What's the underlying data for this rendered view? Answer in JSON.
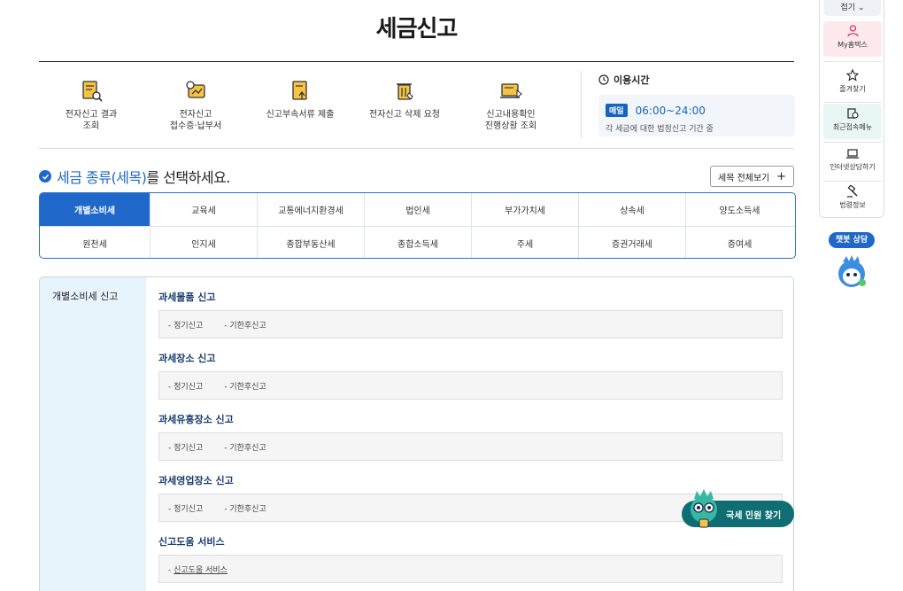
{
  "page": {
    "title": "세금신고"
  },
  "quick_menu": [
    {
      "label": "전자신고 결과\n조회",
      "icon": "document-search-icon"
    },
    {
      "label": "전자신고\n접수증·납부서",
      "icon": "receipt-payment-icon"
    },
    {
      "label": "신고부속서류 제출",
      "icon": "document-upload-icon"
    },
    {
      "label": "전자신고 삭제 요청",
      "icon": "trash-request-icon"
    },
    {
      "label": "신고내용확인\n진행상황 조회",
      "icon": "laptop-check-icon"
    }
  ],
  "usage_time": {
    "heading": "이용시간",
    "badge": "매일",
    "time": "06:00~24:00",
    "desc": "각 세금에 대한 법정신고 기간 중"
  },
  "selection": {
    "heading_pre": "세금 종류(세목)",
    "heading_post": "를 선택하세요.",
    "view_all": "세목 전체보기",
    "view_all_icon": "+"
  },
  "tabs": {
    "row1": [
      "개별소비세",
      "교육세",
      "교통에너지환경세",
      "법인세",
      "부가가치세",
      "상속세",
      "양도소득세"
    ],
    "row2": [
      "원천세",
      "인지세",
      "종합부동산세",
      "종합소득세",
      "주세",
      "증권거래세",
      "증여세"
    ],
    "active": "개별소비세"
  },
  "panel": {
    "side_label": "개별소비세 신고",
    "groups": [
      {
        "title": "과세물품 신고",
        "links": [
          "정기신고",
          "기한후신고"
        ]
      },
      {
        "title": "과세장소 신고",
        "links": [
          "정기신고",
          "기한후신고"
        ]
      },
      {
        "title": "과세유흥장소 신고",
        "links": [
          "정기신고",
          "기한후신고"
        ]
      },
      {
        "title": "과세영업장소 신고",
        "links": [
          "정기신고",
          "기한후신고"
        ]
      },
      {
        "title": "신고도움 서비스",
        "links": [
          "신고도움 서비스"
        ]
      }
    ]
  },
  "right_bar": {
    "fold": "접기",
    "items": [
      "My홈택스",
      "즐겨찾기",
      "최근접속메뉴",
      "인터넷상담하기",
      "법령정보"
    ]
  },
  "chatbot": {
    "label": "챗봇 상담"
  },
  "find_button": {
    "label": "국세 민원 찾기"
  },
  "colors": {
    "primary": "#1f68c9",
    "side_bg": "#e8f4fb",
    "find_btn": "#0f6e73"
  }
}
